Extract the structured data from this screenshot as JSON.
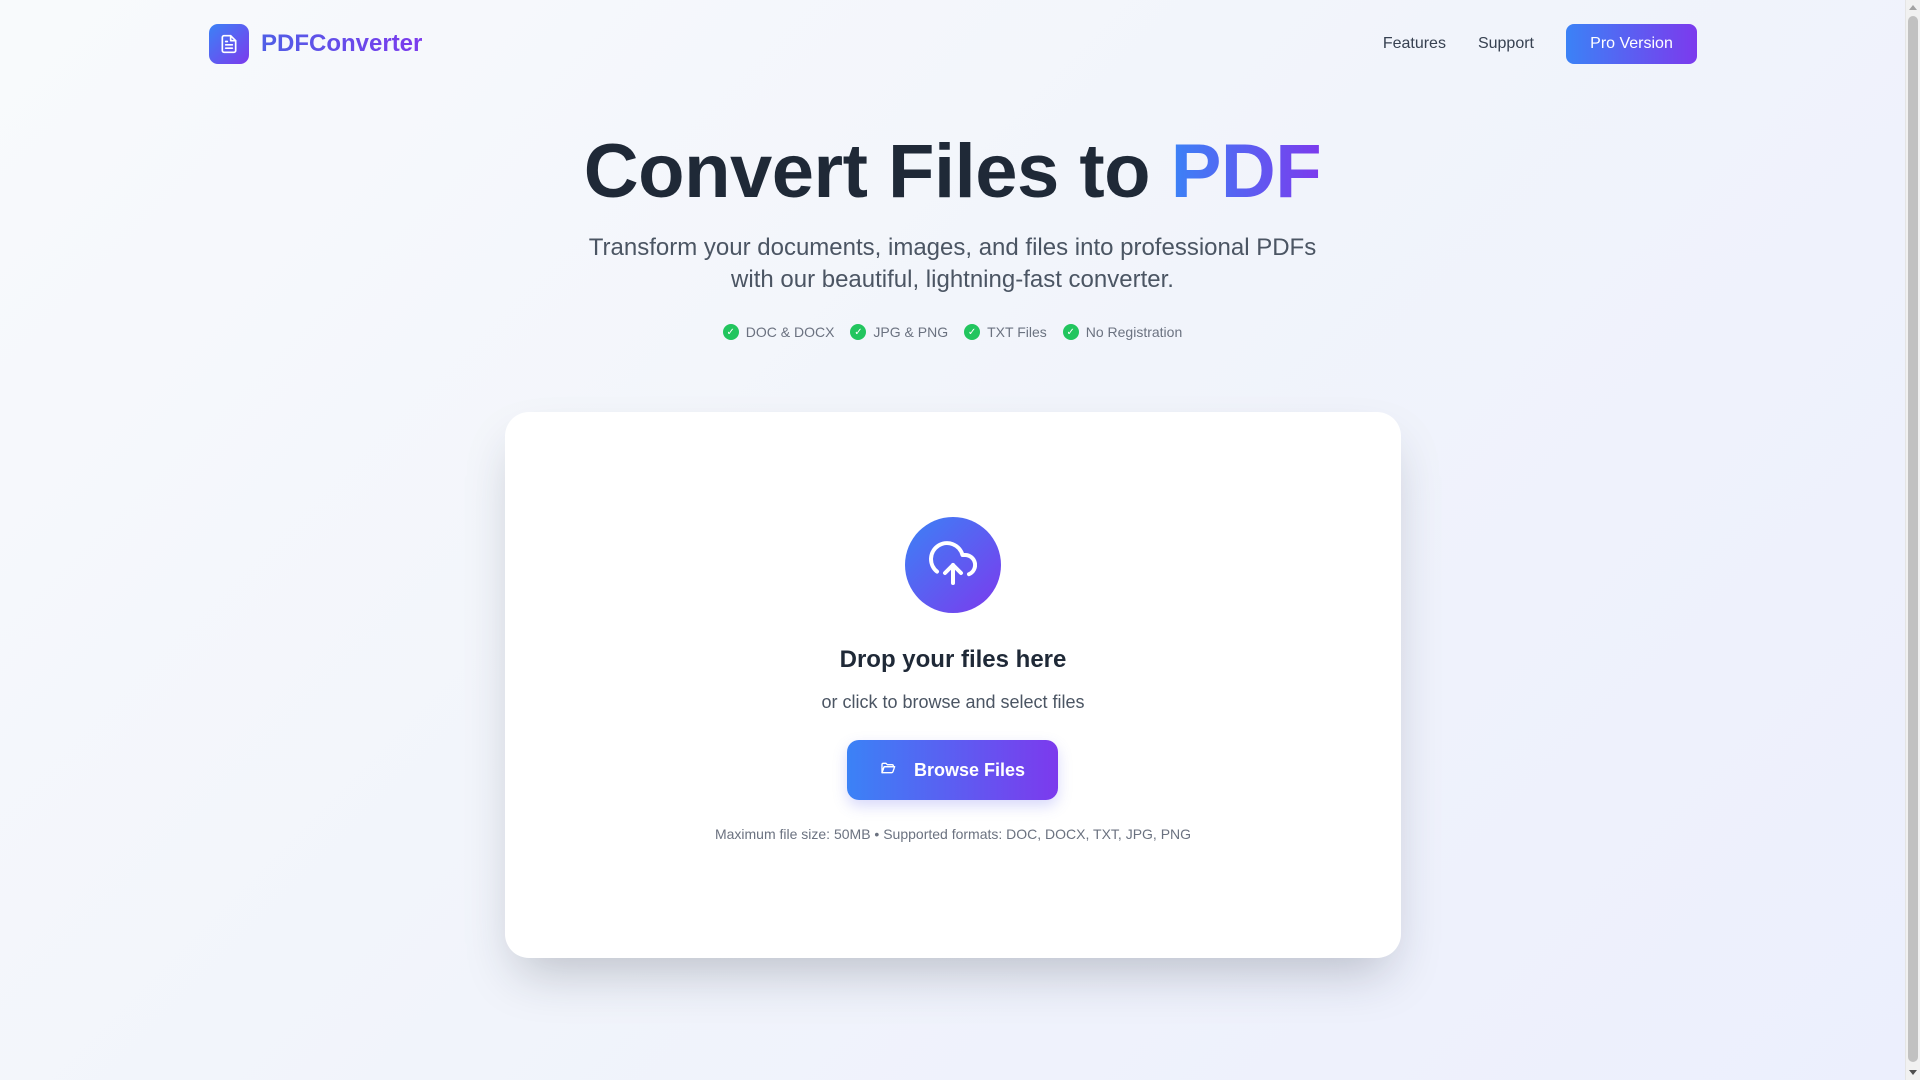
{
  "brand": {
    "name": "PDFConverter",
    "logo_icon": "document-icon"
  },
  "nav": {
    "links": [
      "Features",
      "Support"
    ],
    "cta_label": "Pro Version"
  },
  "hero": {
    "title_main": "Convert Files to",
    "title_accent": "PDF",
    "subtitle": "Transform your documents, images, and files into professional PDFs with our beautiful, lightning-fast converter.",
    "badges": [
      "DOC & DOCX",
      "JPG & PNG",
      "TXT Files",
      "No Registration"
    ],
    "badge_icon": "check-icon"
  },
  "upload": {
    "icon": "cloud-upload-icon",
    "title": "Drop your files here",
    "subtitle": "or click to browse and select files",
    "button_label": "Browse Files",
    "button_icon": "folder-open-icon",
    "info": "Maximum file size: 50MB • Supported formats: DOC, DOCX, TXT, JPG, PNG"
  },
  "colors": {
    "accent_start": "#3b82f6",
    "accent_end": "#7c3aed",
    "check": "#22c55e",
    "heading": "#1f2937"
  }
}
